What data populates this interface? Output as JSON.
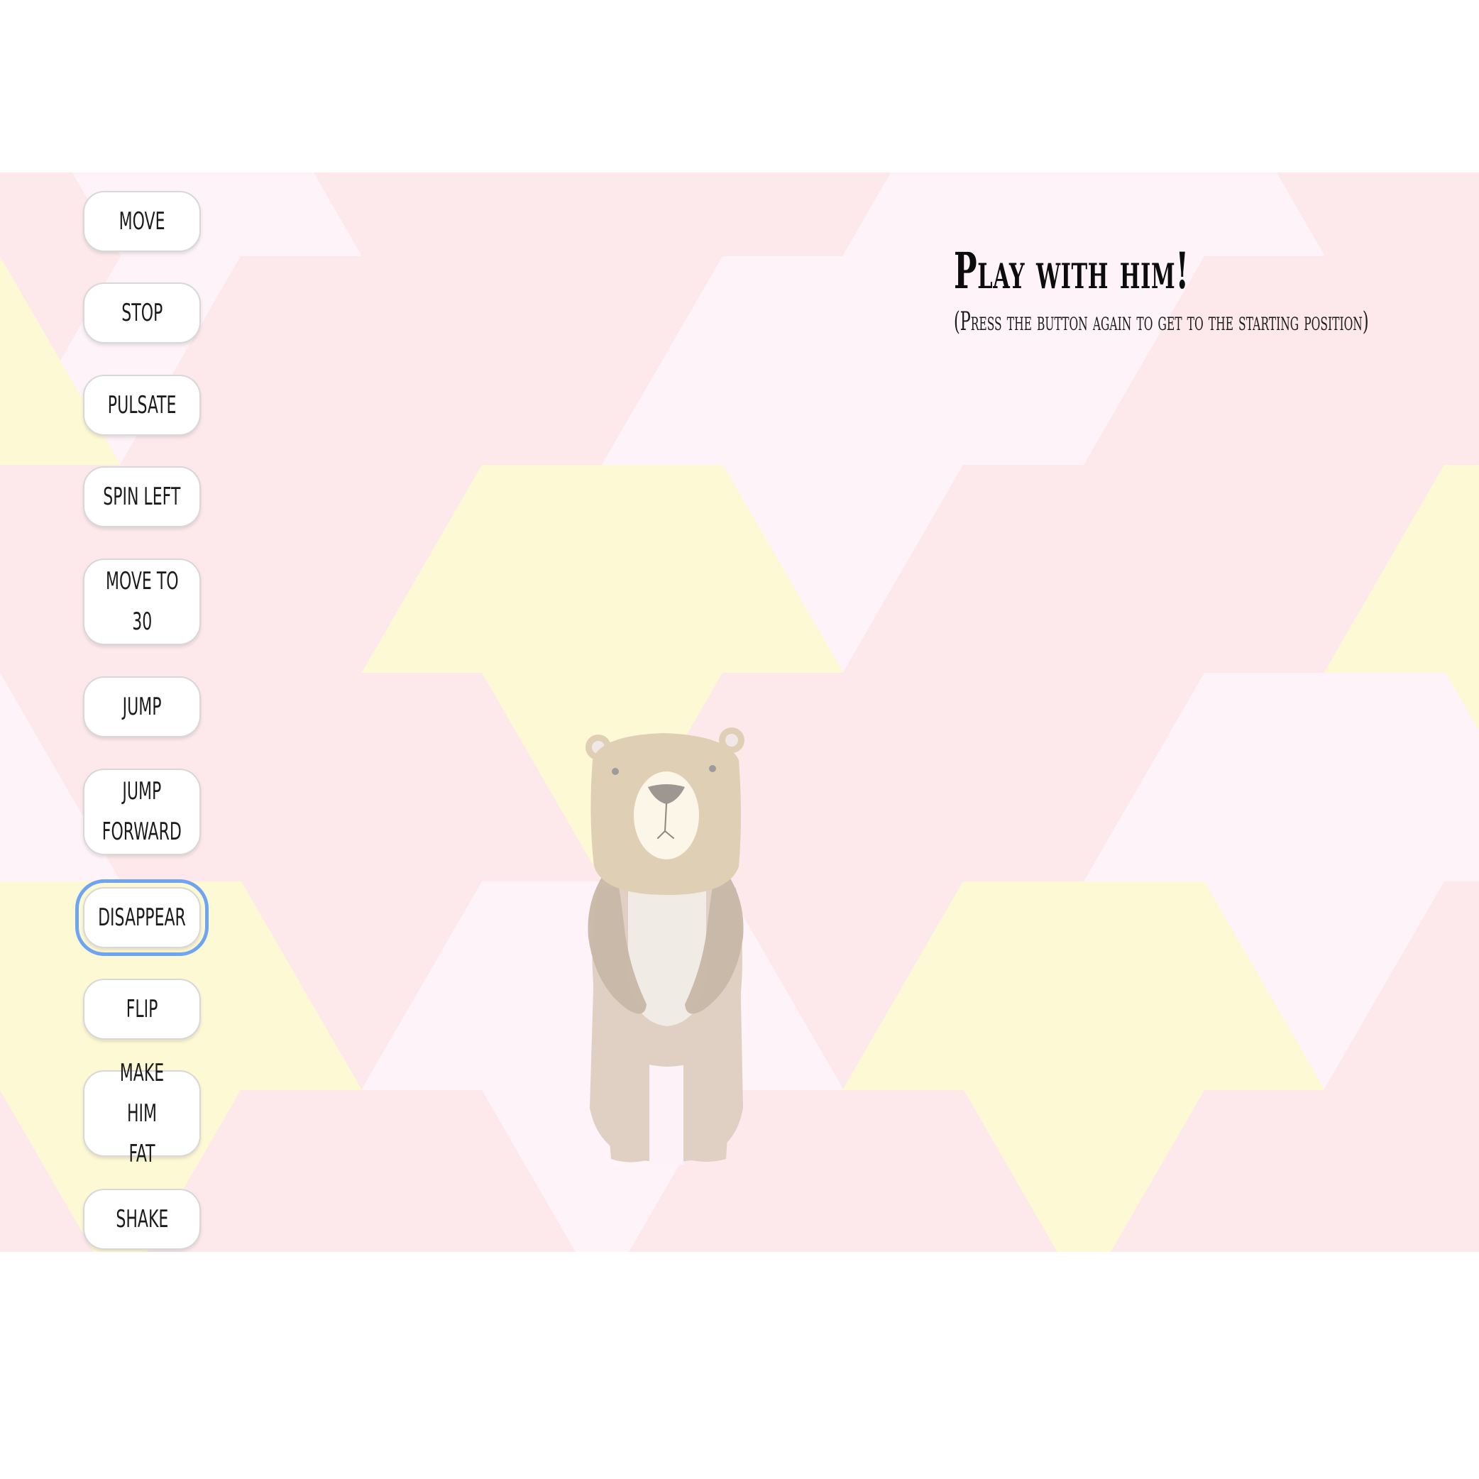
{
  "heading": {
    "title": "Play with him!",
    "subtitle": "(Press the button again to get to the starting position)"
  },
  "controls": [
    {
      "id": "move",
      "label": "MOVE"
    },
    {
      "id": "stop",
      "label": "STOP"
    },
    {
      "id": "pulsate",
      "label": "PULSATE"
    },
    {
      "id": "spin-left",
      "label": "SPIN LEFT"
    },
    {
      "id": "move-to-30",
      "label": "MOVE TO\n30"
    },
    {
      "id": "jump",
      "label": "JUMP"
    },
    {
      "id": "jump-forward",
      "label": "JUMP\nFORWARD"
    },
    {
      "id": "disappear",
      "label": "DISAPPEAR",
      "focused": true
    },
    {
      "id": "flip",
      "label": "FLIP"
    },
    {
      "id": "make-him-fat",
      "label": "MAKE HIM\nFAT"
    },
    {
      "id": "shake",
      "label": "SHAKE"
    }
  ],
  "colors": {
    "hex_pink": "#fde9ec",
    "hex_light_pink": "#fdf3f8",
    "hex_yellow": "#fdf9d5",
    "button_border": "#d8d8d8",
    "focus_outline": "#6fa4f3",
    "bear_fur": "#dfcfb4",
    "bear_arm": "#c7b7a6",
    "bear_belly": "#f0ebe4"
  },
  "character": {
    "icon": "bear-illustration"
  }
}
